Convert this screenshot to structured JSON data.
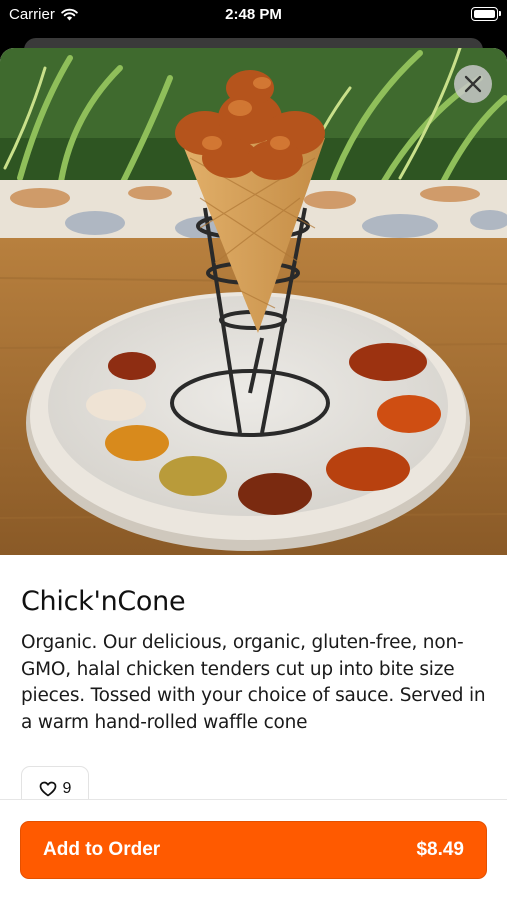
{
  "status_bar": {
    "carrier": "Carrier",
    "time": "2:48 PM"
  },
  "item": {
    "title": "Chick'nCone",
    "description": "Organic. Our delicious, organic, gluten-free, non-GMO, halal chicken tenders cut up into bite size pieces. Tossed with your choice of sauce. Served in a warm hand-rolled waffle cone",
    "likes": "9",
    "photo_alt": "Chicken tenders in a waffle cone on a stand, plate with dipping sauces"
  },
  "order_button": {
    "label": "Add to Order",
    "price": "$8.49"
  },
  "icons": {
    "wifi": "wifi-icon",
    "battery": "battery-icon",
    "close": "close-icon",
    "heart": "heart-icon"
  },
  "colors": {
    "accent": "#ff5a00",
    "text": "#111111",
    "close_button_bg": "#c8c8c8"
  }
}
